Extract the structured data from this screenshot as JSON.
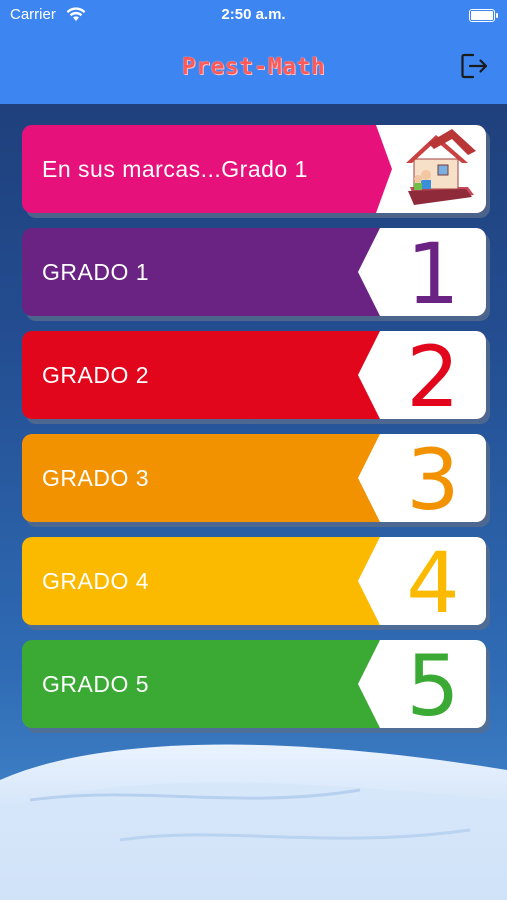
{
  "status_bar": {
    "carrier": "Carrier",
    "time": "2:50 a.m."
  },
  "header": {
    "title": "Prest-Math",
    "logout_icon": "logout-icon"
  },
  "menu": [
    {
      "label": "En sus marcas...Grado 1",
      "badge": "",
      "color": "#e6117b",
      "icon": "house-books-icon"
    },
    {
      "label": "GRADO 1",
      "badge": "1",
      "color": "#6a2383",
      "digit_color": "#6a2383"
    },
    {
      "label": "GRADO 2",
      "badge": "2",
      "color": "#e2061c",
      "digit_color": "#e2061c"
    },
    {
      "label": "GRADO 3",
      "badge": "3",
      "color": "#f39200",
      "digit_color": "#f39200"
    },
    {
      "label": "GRADO 4",
      "badge": "4",
      "color": "#fbba00",
      "digit_color": "#fbba00"
    },
    {
      "label": "GRADO 5",
      "badge": "5",
      "color": "#3aaa35",
      "digit_color": "#3aaa35"
    }
  ]
}
